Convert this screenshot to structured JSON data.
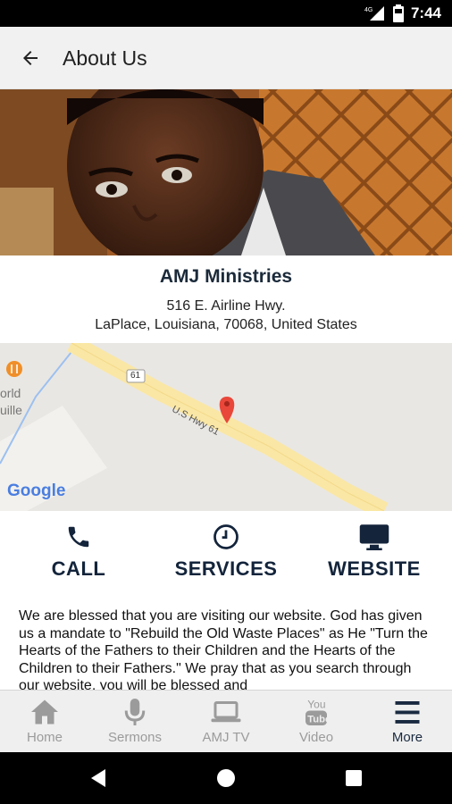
{
  "status_bar": {
    "time": "7:44",
    "network": "4G",
    "icons": [
      "signal-icon",
      "battery-icon"
    ]
  },
  "app_bar": {
    "title": "About Us",
    "back_icon": "arrow-left-icon"
  },
  "organization": {
    "name": "AMJ Ministries",
    "address_line1": "516 E. Airline Hwy.",
    "address_line2": "LaPlace, Louisiana, 70068, United States"
  },
  "map": {
    "road_label": "U.S Hwy 61",
    "route_shield": "61",
    "poi_label_1": "orld",
    "poi_label_2": "uille",
    "google_logo": "Google"
  },
  "actions": [
    {
      "label": "CALL",
      "icon": "phone-icon"
    },
    {
      "label": "SERVICES",
      "icon": "clock-icon"
    },
    {
      "label": "WEBSITE",
      "icon": "monitor-icon"
    }
  ],
  "description": "We are blessed that you are visiting our website. God has given us a mandate to \"Rebuild the Old Waste Places\" as He \"Turn the Hearts of the Fathers to their Children and the Hearts of the Children to their Fathers.\" We pray that as you search through our website, you will be blessed and",
  "tabs": [
    {
      "label": "Home",
      "icon": "home-icon",
      "active": false
    },
    {
      "label": "Sermons",
      "icon": "microphone-icon",
      "active": false
    },
    {
      "label": "AMJ TV",
      "icon": "laptop-icon",
      "active": false
    },
    {
      "label": "Video",
      "icon": "youtube-icon",
      "active": false
    },
    {
      "label": "More",
      "icon": "menu-icon",
      "active": true
    }
  ],
  "colors": {
    "accent": "#13243b",
    "inactive_tab": "#9b9b9b",
    "app_bar_bg": "#f1f1f1",
    "map_pin": "#e8473a"
  }
}
